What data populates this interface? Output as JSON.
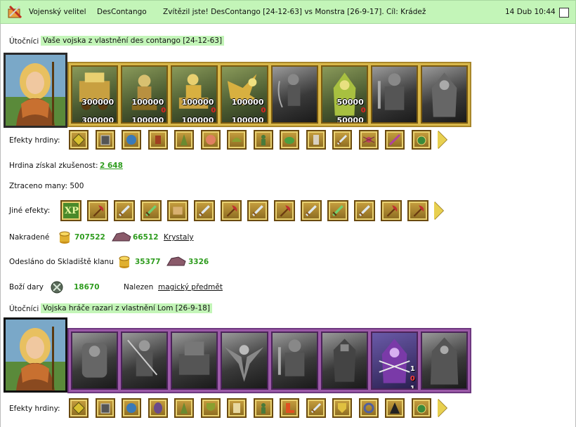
{
  "header": {
    "title": "Vojenský velitel",
    "player": "DesContango",
    "message": "Zvítězil jste! DesContango [24-12-63] vs Monstra [26-9-17]. Cíl: Krádež",
    "date": "14 Dub 10:44"
  },
  "attacker1": {
    "label": "Útočníci",
    "army_title": "Vaše vojska z vlastnění des contango [24-12-63]",
    "units": [
      {
        "icon": "gold-cart-unit",
        "count": "300000",
        "remaining": "300000",
        "style": "color"
      },
      {
        "icon": "centaur-unit",
        "count": "100000",
        "remaining": "100000",
        "loss": "0",
        "style": "color"
      },
      {
        "icon": "knight-unit",
        "count": "100000",
        "remaining": "100000",
        "loss": "0",
        "style": "color"
      },
      {
        "icon": "griffin-unit",
        "count": "100000",
        "remaining": "100000",
        "loss": "0",
        "style": "color"
      },
      {
        "icon": "archer-unit",
        "style": "gray"
      },
      {
        "icon": "druid-unit",
        "count": "50000",
        "remaining": "50000",
        "loss": "0",
        "style": "color"
      },
      {
        "icon": "warrior-unit",
        "style": "gray"
      },
      {
        "icon": "mage-unit",
        "style": "gray"
      }
    ],
    "effects_label": "Efekty hrdiny:",
    "effects_icons": [
      "gem-icon",
      "armor-icon",
      "orb-icon",
      "lantern-icon",
      "totem-icon",
      "fist-icon",
      "helmet-icon",
      "figure-icon",
      "frog-icon",
      "gauntlet-icon",
      "sword-icon",
      "spider-icon",
      "wand-icon",
      "amulet-icon"
    ],
    "xp_label": "Hrdina získal zkušenost:",
    "xp_value": "2 648",
    "mana_text": "Ztraceno many: 500",
    "other_label": "Jiné efekty:",
    "other_icons": [
      "xp-badge",
      "axe-icon",
      "sword-icon",
      "green-sword-icon",
      "scroll-icon",
      "sword-icon",
      "axe-icon",
      "sword-icon",
      "axe-icon",
      "sword-icon",
      "green-sword-icon",
      "sword-icon",
      "axe-icon",
      "axe-icon"
    ],
    "xp_badge_text": "XP",
    "stolen_label": "Nakradené",
    "stolen_gold": "707522",
    "stolen_crystal": "66512",
    "stolen_crystal_link": "Krystaly",
    "sent_label": "Odesláno do Skladiště klanu",
    "sent_gold": "35377",
    "sent_crystal": "3326",
    "gifts_label": "Boží dary",
    "gifts_value": "18670",
    "found_label": "Nalezen",
    "found_link": "magický předmět"
  },
  "attacker2": {
    "label": "Útočníci",
    "army_title": "Vojska hráče razari z vlastnění Lom [26-9-18]",
    "units": [
      {
        "icon": "golem-unit"
      },
      {
        "icon": "samurai-unit"
      },
      {
        "icon": "siege-unit"
      },
      {
        "icon": "angel-unit"
      },
      {
        "icon": "warrior-unit"
      },
      {
        "icon": "dark-knight-unit"
      },
      {
        "icon": "hooded-mage-unit",
        "side_numbers": [
          "1",
          "0",
          "1"
        ]
      },
      {
        "icon": "wraith-unit"
      }
    ],
    "effects_label": "Efekty hrdiny:",
    "effects_icons": [
      "gem-icon",
      "armor-icon",
      "orb-icon",
      "mask-icon",
      "totem-icon",
      "shield-icon",
      "banner-icon",
      "figure-icon",
      "boot-icon",
      "sword-icon",
      "crest-icon",
      "bracelet-icon",
      "cloak-icon",
      "amulet-icon"
    ]
  },
  "colors": {
    "header_bg": "#c3f5b8",
    "value_green": "#2e9c1e",
    "gold_frame": "#d9b84a",
    "purple_frame": "#9c5aa8"
  }
}
